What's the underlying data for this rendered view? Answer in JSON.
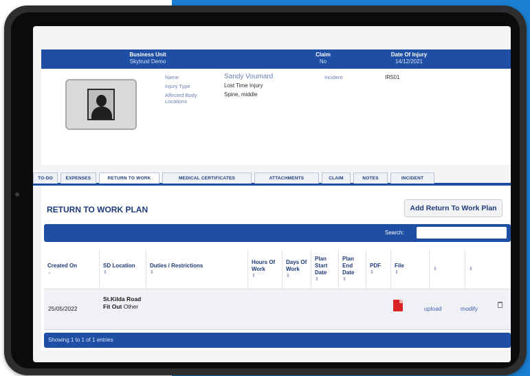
{
  "header": {
    "business_unit_label": "Business Unit",
    "business_unit_value": "Skytrust Demo",
    "claim_label": "Claim",
    "claim_value": "No",
    "date_of_injury_label": "Date Of Injury",
    "date_of_injury_value": "14/12/2021"
  },
  "profile": {
    "name_label": "Name",
    "name_value": "Sandy Voumard",
    "incident_label": "Incident",
    "incident_value": "IR501",
    "injury_type_label": "Injury Type",
    "injury_type_value": "Lost Time Injury",
    "affected_body_label": "Affected Body Locations",
    "affected_body_value": "Spine, middle"
  },
  "tabs": [
    {
      "label": "TO-DO"
    },
    {
      "label": "EXPENSES"
    },
    {
      "label": "RETURN TO WORK"
    },
    {
      "label": "MEDICAL CERTIFICATES"
    },
    {
      "label": "ATTACHMENTS"
    },
    {
      "label": "CLAIM"
    },
    {
      "label": "NOTES"
    },
    {
      "label": "INCIDENT"
    }
  ],
  "active_tab": "RETURN TO WORK",
  "panel": {
    "title": "RETURN TO WORK PLAN",
    "add_button": "Add Return To Work Plan",
    "search_label": "Search:",
    "search_value": ""
  },
  "table": {
    "columns": [
      {
        "label": "Created On",
        "sort": "⌄"
      },
      {
        "label": "SD Location",
        "sort": "⇕"
      },
      {
        "label": "Duties / Restrictions",
        "sort": "⇕"
      },
      {
        "label": "Hours Of Work",
        "sort": "⇕"
      },
      {
        "label": "Days Of Work",
        "sort": "⇕"
      },
      {
        "label": "Plan Start Date",
        "sort": "⇕"
      },
      {
        "label": "Plan End Date",
        "sort": "⇕"
      },
      {
        "label": "PDF",
        "sort": "⇕"
      },
      {
        "label": "File",
        "sort": "⇕"
      },
      {
        "label": "",
        "sort": "⇕"
      },
      {
        "label": "",
        "sort": "⇕"
      }
    ],
    "rows": [
      {
        "created_on": "25/05/2022",
        "sd_location_bold": "St.Kilda Road Fit Out",
        "sd_location_rest": "Other",
        "upload_label": "upload",
        "modify_label": "modify"
      }
    ],
    "footer": "Showing 1 to 1 of 1 entries"
  },
  "colors": {
    "brand_blue": "#1e4fa5",
    "background_blue": "#1a7fd0",
    "pdf_red": "#d92323"
  },
  "icons": [
    "pdf-icon",
    "trash-icon",
    "avatar-placeholder-icon"
  ]
}
